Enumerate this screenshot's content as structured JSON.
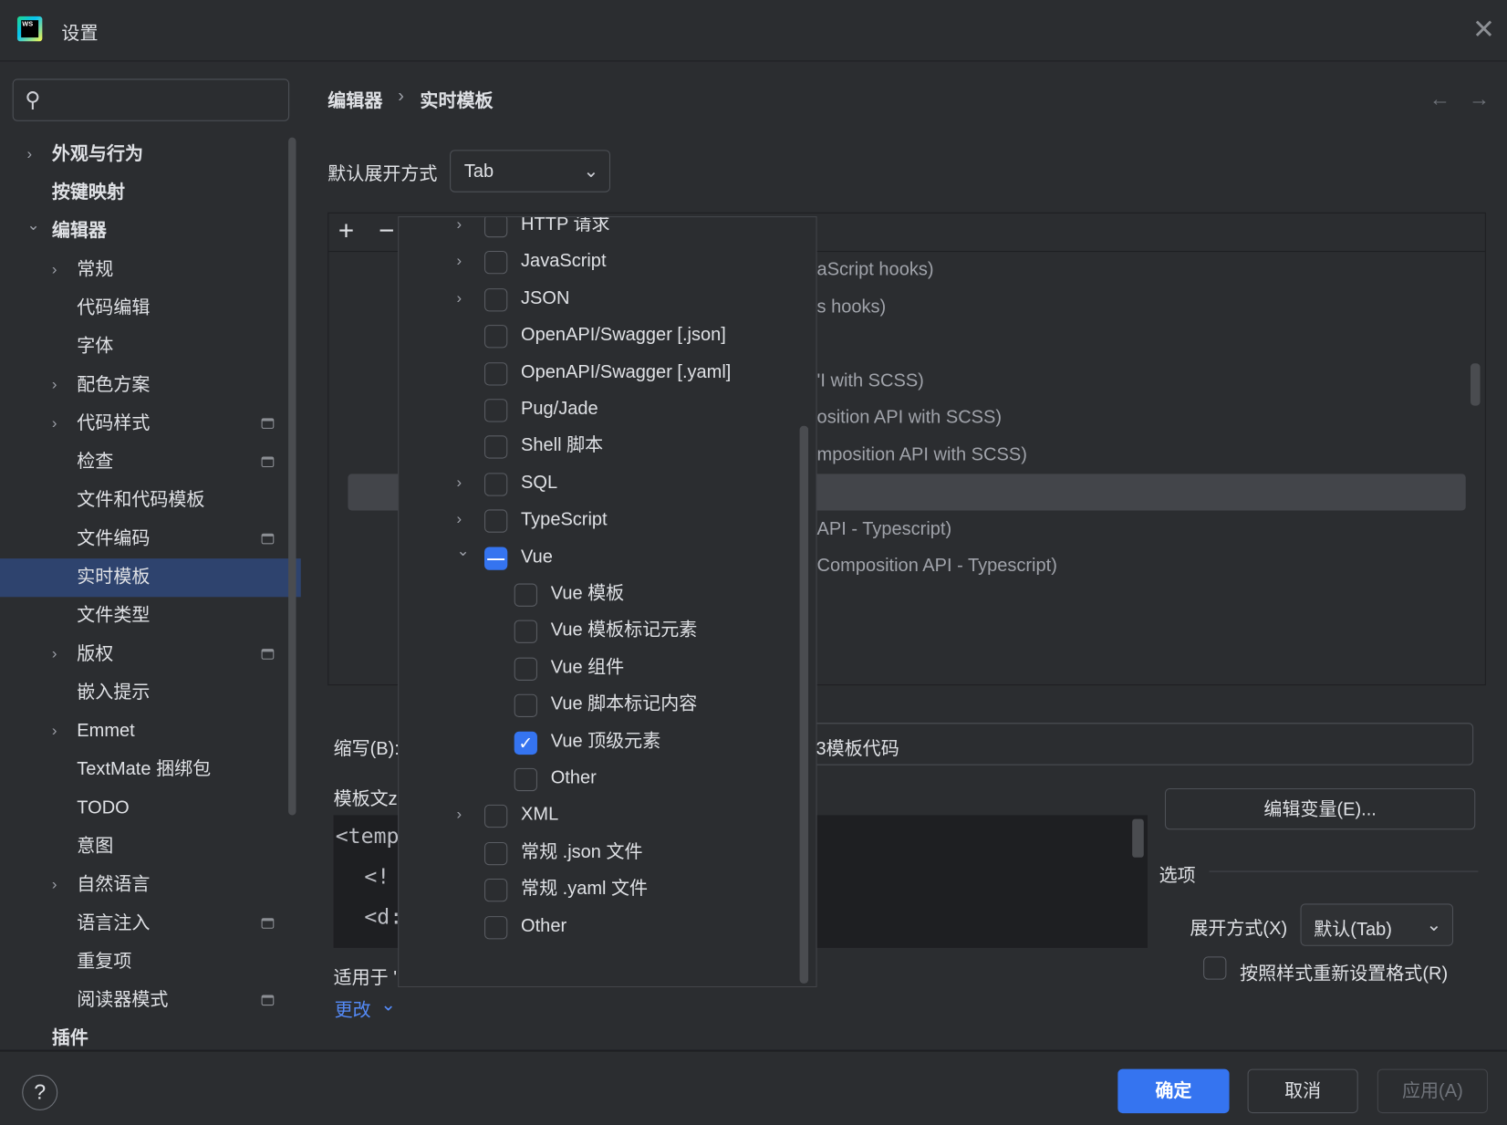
{
  "window": {
    "title": "设置",
    "close_icon": "close-icon",
    "logo": "webstorm-logo"
  },
  "search": {
    "placeholder": "",
    "icon": "search-icon"
  },
  "sidebar": {
    "items": [
      {
        "label": "外观与行为",
        "bold": true,
        "chevron": "right",
        "level": 0
      },
      {
        "label": "按键映射",
        "bold": true,
        "level": 0
      },
      {
        "label": "编辑器",
        "bold": true,
        "chevron": "down",
        "level": 0
      },
      {
        "label": "常规",
        "chevron": "right",
        "level": 1
      },
      {
        "label": "代码编辑",
        "level": 1
      },
      {
        "label": "字体",
        "level": 1
      },
      {
        "label": "配色方案",
        "chevron": "right",
        "level": 1
      },
      {
        "label": "代码样式",
        "chevron": "right",
        "level": 1,
        "project_icon": true
      },
      {
        "label": "检查",
        "level": 1,
        "project_icon": true
      },
      {
        "label": "文件和代码模板",
        "level": 1
      },
      {
        "label": "文件编码",
        "level": 1,
        "project_icon": true
      },
      {
        "label": "实时模板",
        "level": 1,
        "selected": true
      },
      {
        "label": "文件类型",
        "level": 1
      },
      {
        "label": "版权",
        "chevron": "right",
        "level": 1,
        "project_icon": true
      },
      {
        "label": "嵌入提示",
        "level": 1
      },
      {
        "label": "Emmet",
        "chevron": "right",
        "level": 1
      },
      {
        "label": "TextMate 捆绑包",
        "level": 1
      },
      {
        "label": "TODO",
        "level": 1
      },
      {
        "label": "意图",
        "level": 1
      },
      {
        "label": "自然语言",
        "chevron": "right",
        "level": 1
      },
      {
        "label": "语言注入",
        "level": 1,
        "project_icon": true
      },
      {
        "label": "重复项",
        "level": 1
      },
      {
        "label": "阅读器模式",
        "level": 1,
        "project_icon": true
      },
      {
        "label": "插件",
        "bold": true,
        "level": 0
      }
    ]
  },
  "breadcrumb": {
    "parent": "编辑器",
    "separator": "›",
    "current": "实时模板"
  },
  "nav": {
    "back": "←",
    "forward": "→"
  },
  "expand_default": {
    "label": "默认展开方式",
    "value": "Tab"
  },
  "toolbar": {
    "add": "+",
    "remove": "−"
  },
  "background_rows": [
    "aScript hooks)",
    "s hooks)",
    "",
    "'I with SCSS)",
    "osition API with SCSS)",
    "mposition API with SCSS)",
    "",
    "API - Typescript)",
    "Composition API - Typescript)"
  ],
  "popup": {
    "items": [
      {
        "label": "HTTP 请求",
        "chevron": "right",
        "checked": false,
        "level": 0
      },
      {
        "label": "JavaScript",
        "chevron": "right",
        "checked": false,
        "level": 0
      },
      {
        "label": "JSON",
        "chevron": "right",
        "checked": false,
        "level": 0
      },
      {
        "label": "OpenAPI/Swagger [.json]",
        "checked": false,
        "level": 0
      },
      {
        "label": "OpenAPI/Swagger [.yaml]",
        "checked": false,
        "level": 0
      },
      {
        "label": "Pug/Jade",
        "checked": false,
        "level": 0
      },
      {
        "label": "Shell 脚本",
        "checked": false,
        "level": 0
      },
      {
        "label": "SQL",
        "chevron": "right",
        "checked": false,
        "level": 0
      },
      {
        "label": "TypeScript",
        "chevron": "right",
        "checked": false,
        "level": 0
      },
      {
        "label": "Vue",
        "chevron": "down",
        "checked": "partial",
        "level": 0
      },
      {
        "label": "Vue 模板",
        "checked": false,
        "level": 1
      },
      {
        "label": "Vue 模板标记元素",
        "checked": false,
        "level": 1
      },
      {
        "label": "Vue 组件",
        "checked": false,
        "level": 1
      },
      {
        "label": "Vue 脚本标记内容",
        "checked": false,
        "level": 1
      },
      {
        "label": "Vue 顶级元素",
        "checked": true,
        "level": 1
      },
      {
        "label": "Other",
        "checked": false,
        "level": 1
      },
      {
        "label": "XML",
        "chevron": "right",
        "checked": false,
        "level": 0
      },
      {
        "label": "常规 .json 文件",
        "checked": false,
        "level": 0
      },
      {
        "label": "常规 .yaml 文件",
        "checked": false,
        "level": 0
      },
      {
        "label": "Other",
        "checked": false,
        "level": 0
      }
    ]
  },
  "abbrev": {
    "label": "缩写(B):",
    "description_fragment": "3模板代码"
  },
  "template_text": {
    "label": "模板文z",
    "lines": [
      "<temp",
      "  <!",
      "  <d:"
    ]
  },
  "applies_to": {
    "label": "适用于 '",
    "change_link": "更改"
  },
  "edit_vars_button": "编辑变量(E)...",
  "options": {
    "title": "选项",
    "expand_label": "展开方式(X)",
    "expand_value": "默认(Tab)",
    "reformat_label": "按照样式重新设置格式(R)",
    "reformat_checked": false
  },
  "footer": {
    "help": "?",
    "ok": "确定",
    "cancel": "取消",
    "apply": "应用(A)"
  },
  "colors": {
    "accent": "#3574f0",
    "selection": "#2e436e",
    "background": "#2b2d30",
    "link": "#548af7"
  }
}
